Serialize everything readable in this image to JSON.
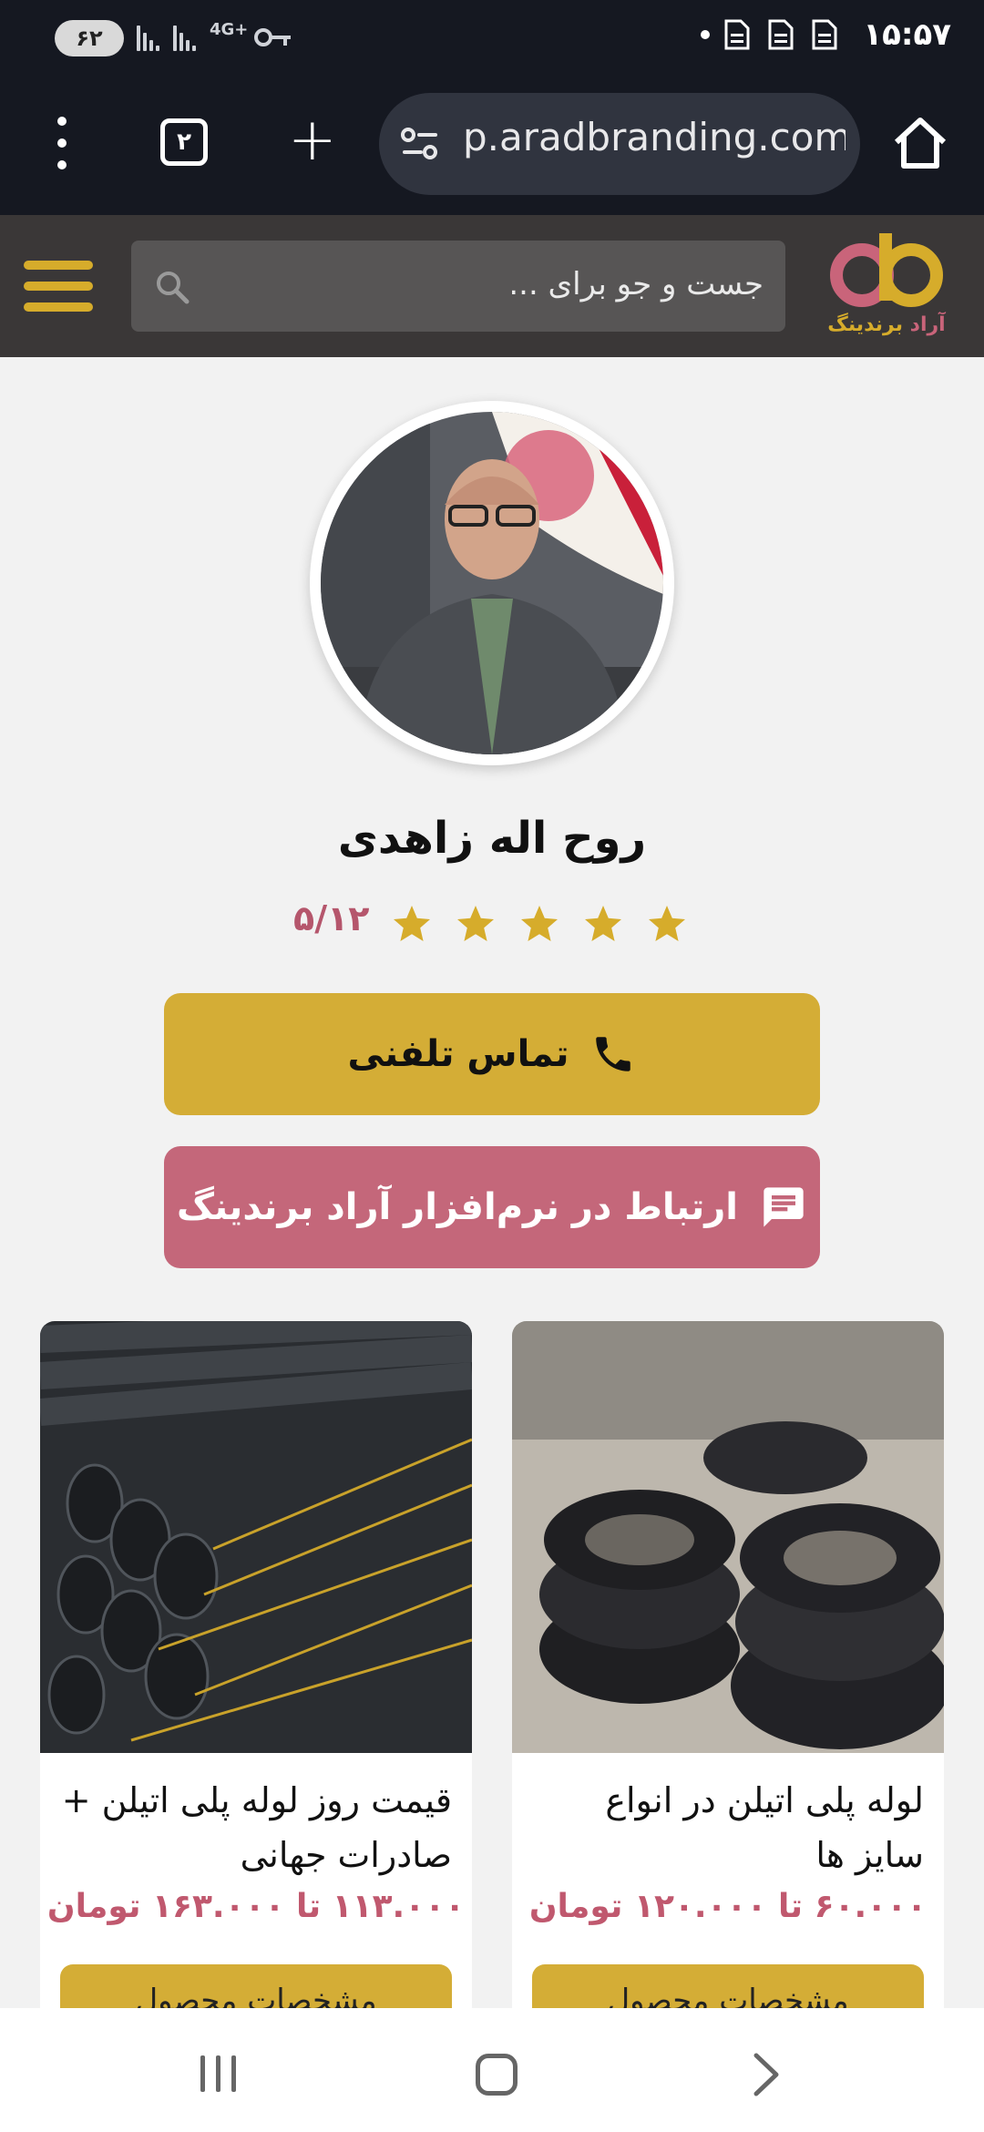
{
  "status_bar": {
    "time": "۱۵:۵۷",
    "battery": "۶۲",
    "network": "4G+"
  },
  "browser": {
    "tabs_count": "۲",
    "url": "p.aradbranding.com",
    "icons": [
      "menu-dots-icon",
      "new-tab-icon",
      "site-settings-icon",
      "home-icon"
    ]
  },
  "site_header": {
    "search_placeholder": "جست و جو برای ...",
    "logo_text_pink": "آراد",
    "logo_text_gold": "برندینگ",
    "colors": {
      "gold": "#d6ac2b",
      "pink": "#c9647a",
      "header_bg": "#3a3737"
    }
  },
  "profile": {
    "name": "روح اله زاهدی",
    "rating": "۵/۱۲",
    "stars": 5,
    "call_button": "تماس تلفنی",
    "app_button": "ارتباط در نرم‌افزار آراد برندینگ"
  },
  "products": [
    {
      "title": "لوله پلی اتیلن در انواع سایز ها",
      "price": "۶۰.۰۰۰ تا ۱۲۰.۰۰۰ تومان",
      "button": "مشخصات محصول"
    },
    {
      "title": "قیمت روز لوله پلی اتیلن + صادرات جهانی",
      "price": "۱۱۳.۰۰۰ تا ۱۶۳.۰۰۰ تومان",
      "button": "مشخصات محصول"
    }
  ]
}
